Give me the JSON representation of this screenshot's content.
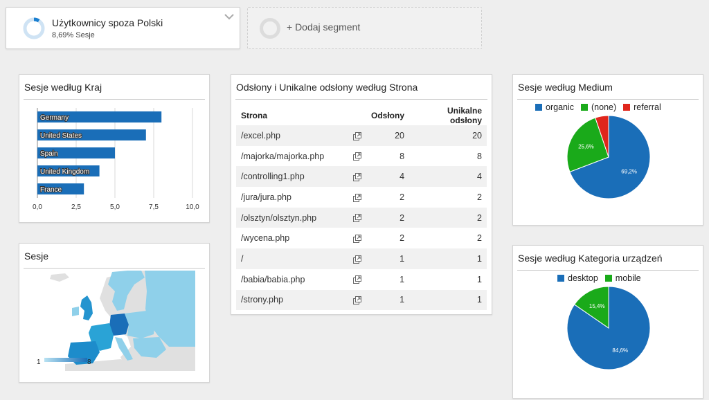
{
  "segment": {
    "title": "Użytkownicy spoza Polski",
    "subtitle": "8,69% Sesje"
  },
  "add_segment": {
    "label": "+ Dodaj segment"
  },
  "colors": {
    "primary": "#1a6eb8",
    "green": "#1aaa1a",
    "red": "#e0261c"
  },
  "country_panel": {
    "title": "Sesje według Kraj",
    "chart_data": {
      "type": "bar",
      "orientation": "horizontal",
      "categories": [
        "Germany",
        "United States",
        "Spain",
        "United Kingdom",
        "France"
      ],
      "values": [
        8,
        7,
        5,
        4,
        3
      ],
      "xlim": [
        0,
        10
      ],
      "xticks": [
        "0,0",
        "2,5",
        "5,0",
        "7,5",
        "10,0"
      ],
      "grid": true
    }
  },
  "map_panel": {
    "title": "Sesje",
    "legend_min": "1",
    "legend_max": "8"
  },
  "pages_panel": {
    "title": "Odsłony i Unikalne odsłony według Strona",
    "columns": [
      "Strona",
      "Odsłony",
      "Unikalne odsłony"
    ],
    "rows": [
      {
        "page": "/excel.php",
        "views": "20",
        "unique": "20"
      },
      {
        "page": "/majorka/majorka.php",
        "views": "8",
        "unique": "8"
      },
      {
        "page": "/controlling1.php",
        "views": "4",
        "unique": "4"
      },
      {
        "page": "/jura/jura.php",
        "views": "2",
        "unique": "2"
      },
      {
        "page": "/olsztyn/olsztyn.php",
        "views": "2",
        "unique": "2"
      },
      {
        "page": "/wycena.php",
        "views": "2",
        "unique": "2"
      },
      {
        "page": "/",
        "views": "1",
        "unique": "1"
      },
      {
        "page": "/babia/babia.php",
        "views": "1",
        "unique": "1"
      },
      {
        "page": "/strony.php",
        "views": "1",
        "unique": "1"
      }
    ]
  },
  "medium_panel": {
    "title": "Sesje według Medium",
    "chart_data": {
      "type": "pie",
      "categories": [
        "organic",
        "(none)",
        "referral"
      ],
      "values": [
        69.2,
        25.6,
        5.2
      ],
      "labels": [
        "69,2%",
        "25,6%",
        ""
      ],
      "colors": [
        "#1a6eb8",
        "#1aaa1a",
        "#e0261c"
      ],
      "legend": "top"
    }
  },
  "device_panel": {
    "title": "Sesje według Kategoria urządzeń",
    "chart_data": {
      "type": "pie",
      "categories": [
        "desktop",
        "mobile"
      ],
      "values": [
        84.6,
        15.4
      ],
      "labels": [
        "84,6%",
        "15,4%"
      ],
      "colors": [
        "#1a6eb8",
        "#1aaa1a"
      ],
      "legend": "top"
    }
  }
}
